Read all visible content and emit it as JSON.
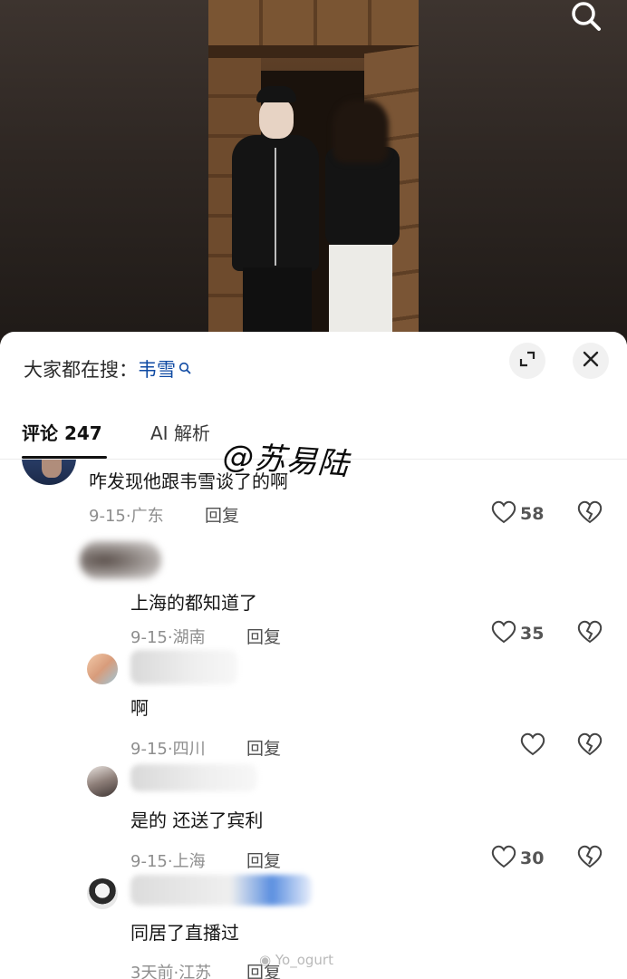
{
  "top_bar": {
    "search_icon": "search-icon"
  },
  "panel": {
    "hot_search_prefix": "大家都在搜：",
    "hot_search_keyword": "韦雪",
    "expand_icon": "expand-icon",
    "close_icon": "close-icon"
  },
  "tabs": [
    {
      "label": "评论 247",
      "active": true
    },
    {
      "label": "AI 解析",
      "active": false
    }
  ],
  "comments": [
    {
      "text": "咋发现他跟韦雪谈了的啊",
      "date": "9-15",
      "location": "广东",
      "reply_label": "回复",
      "likes": "58"
    },
    {
      "text": "上海的都知道了",
      "date": "9-15",
      "location": "湖南",
      "reply_label": "回复",
      "likes": "35"
    },
    {
      "text": "啊",
      "date": "9-15",
      "location": "四川",
      "reply_label": "回复",
      "likes": ""
    },
    {
      "text": "是的 还送了宾利",
      "date": "9-15",
      "location": "上海",
      "reply_label": "回复",
      "likes": "30"
    },
    {
      "text": "同居了直播过",
      "date": "3天前",
      "location": "江苏",
      "reply_label": "回复",
      "likes": ""
    }
  ],
  "annotation": {
    "mention": "@苏易陆"
  },
  "watermark": "Yo_ogurt",
  "colors": {
    "keyword": "#0f4aa3",
    "meta": "#8e8e8e",
    "text": "#161616"
  }
}
